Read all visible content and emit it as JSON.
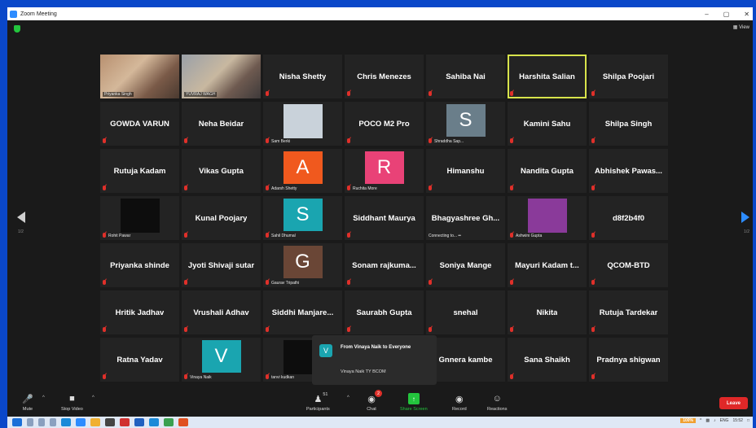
{
  "window": {
    "title": "Zoom Meeting",
    "controls": [
      "–",
      "▢",
      "✕"
    ],
    "view_label": "View"
  },
  "navigation": {
    "prev_page": "1/2",
    "next_page": "1/2"
  },
  "participants": [
    {
      "name": "Priyanka Singh",
      "kind": "video",
      "variant": "vid1"
    },
    {
      "name": "YUVRAJ WAGH",
      "kind": "video",
      "variant": "vid2"
    },
    {
      "name": "Nisha Shetty",
      "kind": "name"
    },
    {
      "name": "Chris Menezes",
      "kind": "name"
    },
    {
      "name": "Sahiba Nai",
      "kind": "name"
    },
    {
      "name": "Harshita Salian",
      "kind": "name",
      "active": true
    },
    {
      "name": "Shilpa Poojari",
      "kind": "name"
    },
    {
      "name": "GOWDA VARUN",
      "kind": "name"
    },
    {
      "name": "Neha Beidar",
      "kind": "name"
    },
    {
      "name": "Sam Berki",
      "kind": "photo",
      "color": "#c9d2da"
    },
    {
      "name": "POCO M2 Pro",
      "kind": "name"
    },
    {
      "name": "Shraddha Sap...",
      "kind": "avatar",
      "letter": "S",
      "color": "#6a7e8a"
    },
    {
      "name": "Kamini Sahu",
      "kind": "name"
    },
    {
      "name": "Shilpa Singh",
      "kind": "name"
    },
    {
      "name": "Rutuja Kadam",
      "kind": "name"
    },
    {
      "name": "Vikas Gupta",
      "kind": "name"
    },
    {
      "name": "Adarsh Shetty",
      "kind": "avatar",
      "letter": "A",
      "color": "#f0591e"
    },
    {
      "name": "Ruchita More",
      "kind": "avatar",
      "letter": "R",
      "color": "#e94277"
    },
    {
      "name": "Himanshu",
      "kind": "name"
    },
    {
      "name": "Nandita Gupta",
      "kind": "name"
    },
    {
      "name": "Abhishek Pawas...",
      "kind": "name"
    },
    {
      "name": "Rohit Pawar",
      "kind": "photo",
      "color": "#0d0d0d"
    },
    {
      "name": "Kunal Poojary",
      "kind": "name"
    },
    {
      "name": "Sahil Dhumal",
      "kind": "avatar",
      "letter": "S",
      "color": "#1aa5b0"
    },
    {
      "name": "Siddhant Maurya",
      "kind": "name"
    },
    {
      "name": "Bhagyashree Gh...",
      "kind": "name",
      "status": "Connecting to... ••"
    },
    {
      "name": "Ashwini Gupta",
      "kind": "photo",
      "color": "#8a3a9a"
    },
    {
      "name": "d8f2b4f0",
      "kind": "name"
    },
    {
      "name": "Priyanka shinde",
      "kind": "name"
    },
    {
      "name": "Jyoti Shivaji sutar",
      "kind": "name"
    },
    {
      "name": "Gaurav Tripathi",
      "kind": "avatar",
      "letter": "G",
      "color": "#6a4636"
    },
    {
      "name": "Sonam rajkuma...",
      "kind": "name"
    },
    {
      "name": "Soniya Mange",
      "kind": "name"
    },
    {
      "name": "Mayuri Kadam t...",
      "kind": "name"
    },
    {
      "name": "QCOM-BTD",
      "kind": "name"
    },
    {
      "name": "Hritik Jadhav",
      "kind": "name"
    },
    {
      "name": "Vrushali Adhav",
      "kind": "name"
    },
    {
      "name": "Siddhi Manjare...",
      "kind": "name"
    },
    {
      "name": "Saurabh Gupta",
      "kind": "name"
    },
    {
      "name": "snehal",
      "kind": "name"
    },
    {
      "name": "Nikita",
      "kind": "name"
    },
    {
      "name": "Rutuja Tardekar",
      "kind": "name"
    },
    {
      "name": "Ratna Yadav",
      "kind": "name"
    },
    {
      "name": "Vinaya Naik",
      "kind": "avatar",
      "letter": "V",
      "color": "#1aa5b0"
    },
    {
      "name": "tanvi kudkan",
      "kind": "photo",
      "color": "#0d0d0d"
    },
    {
      "name": "",
      "kind": "empty"
    },
    {
      "name": "Gnnera kambe",
      "kind": "name"
    },
    {
      "name": "Sana Shaikh",
      "kind": "name"
    },
    {
      "name": "Pradnya shigwan",
      "kind": "name"
    }
  ],
  "chat_popup": {
    "title": "From Vinaya Naik to Everyone",
    "message": "Vinaya Naik TY BCOM",
    "icon_letter": "V"
  },
  "toolbar": {
    "mute": "Mute",
    "stop_video": "Stop Video",
    "participants": "Participants",
    "participants_count": "51",
    "chat": "Chat",
    "chat_badge": "2",
    "share_screen": "Share Screen",
    "record": "Record",
    "reactions": "Reactions",
    "leave": "Leave"
  },
  "taskbar": {
    "battery": "100%",
    "language": "ENG",
    "time": "15:52"
  }
}
